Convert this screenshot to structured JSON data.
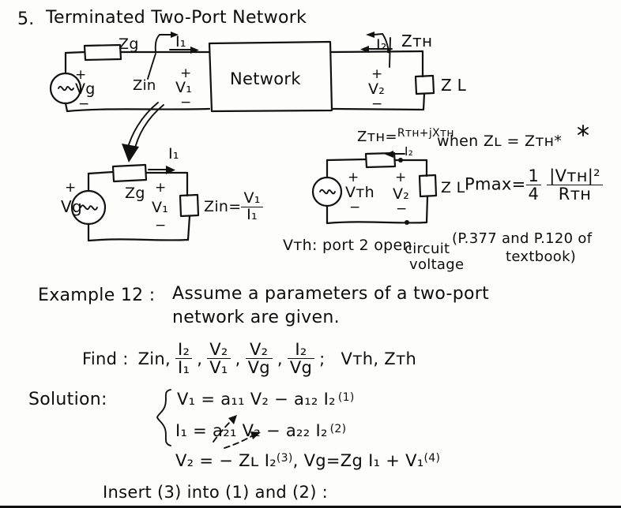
{
  "page": {
    "title_number": "5.",
    "title": "Terminated  Two-Port  Network",
    "ink_color": "#111111",
    "paper_color": "#fdfdfc"
  },
  "figure_top": {
    "name": "terminated-two-port-circuit",
    "source_label": "Vg",
    "source_plus": "+",
    "source_minus": "−",
    "series_impedance": "Zg",
    "input_current": "I₁",
    "input_impedance": "Zin",
    "input_voltage": "V₁",
    "input_plus": "+",
    "input_minus": "−",
    "block_label": "Network",
    "output_current": "I₂",
    "output_voltage": "V₂",
    "output_plus": "+",
    "output_minus": "−",
    "thevenin_impedance": "Zтн",
    "load_impedance": "Z L"
  },
  "figure_left": {
    "name": "input-impedance-circuit",
    "source_label": "Vg",
    "source_plus": "+",
    "source_minus": "−",
    "series_impedance": "Zg",
    "current_label": "I₁",
    "voltage_label": "V₁",
    "voltage_plus": "+",
    "voltage_minus": "−",
    "zin_expr_lhs": "Zin=",
    "zin_num": "V₁",
    "zin_den": "I₁"
  },
  "figure_right": {
    "name": "thevenin-equivalent-circuit",
    "zth_definition_lhs": "Zтн=",
    "zth_definition_rhs": "Rтн+jXтн",
    "source_label": "Vтh",
    "source_plus": "+",
    "source_minus": "−",
    "current_label": "I₂",
    "voltage_label": "V₂",
    "voltage_plus": "+",
    "voltage_minus": "−",
    "load_impedance": "Z L"
  },
  "notes": {
    "when_condition_lhs": "when  Z",
    "when_condition": "when  Zʟ = Zтн*",
    "pmax_label": "Pmax=",
    "pmax_coeff_num": "1",
    "pmax_coeff_den": "4",
    "pmax_frac_num": "|Vтн|²",
    "pmax_frac_den": "Rтн",
    "reference_line1": "(P.377 and P.120 of",
    "reference_line2": "textbook)",
    "vth_note_line1": "Vтh: port 2 open",
    "vth_note_line2": "circuit",
    "vth_note_line3": "voltage"
  },
  "example": {
    "heading": "Example 12 :",
    "statement_line1": "Assume   a  parameters  of  a  two-port",
    "statement_line2": "network  are  given.",
    "find_label": "Find :",
    "find_first": "Zin,",
    "find_ratios": [
      {
        "num": "I₂",
        "den": "I₁"
      },
      {
        "num": "V₂",
        "den": "V₁"
      },
      {
        "num": "V₂",
        "den": "Vg"
      },
      {
        "num": "I₂",
        "den": "Vg"
      }
    ],
    "find_separators": [
      ",",
      ",",
      ",",
      ";"
    ],
    "find_tail": "Vтh, Zтh"
  },
  "solution": {
    "heading": "Solution:",
    "equations": [
      {
        "text": "V₁ = a₁₁ V₂ − a₁₂ I₂",
        "tag": "(1)"
      },
      {
        "text": "I₁ = a₂₁ V₂ − a₂₂ I₂",
        "tag": "(2)"
      }
    ],
    "equation_line3_a": "V₂ = − Zʟ I₂",
    "equation_line3_a_tag": "(3)",
    "equation_line3_b": ", Vg=Zg I₁ + V₁",
    "equation_line3_b_tag": "(4)",
    "closing_line": "Insert (3) into (1) and (2) :"
  }
}
